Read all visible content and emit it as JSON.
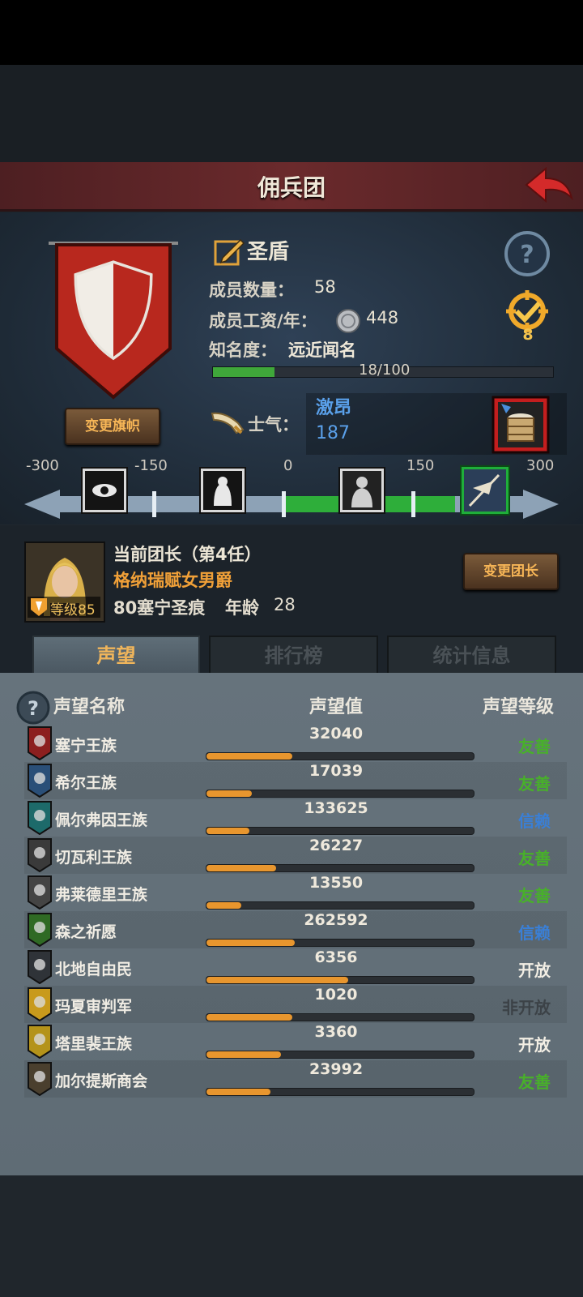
{
  "title": "佣兵团",
  "mercenary": {
    "name": "圣盾",
    "member_count_label": "成员数量：",
    "member_count": "58",
    "salary_label": "成员工资/年：",
    "salary": "448",
    "fame_label": "知名度：",
    "fame_value": "远近闻名",
    "fame_progress": "18/100",
    "fame_fraction": 0.18,
    "medal_count": "8",
    "change_flag_label": "变更旗帜"
  },
  "morale": {
    "label": "士气：",
    "state": "激昂",
    "value": "187",
    "ticks": [
      "-300",
      "-150",
      "0",
      "150",
      "300"
    ]
  },
  "leader": {
    "title": "当前团长（第4任）",
    "name": "格纳瑞赋女男爵",
    "info": "80塞宁圣痕",
    "age_label": "年龄",
    "age": "28",
    "level": "等级85",
    "change_label": "变更团长"
  },
  "tabs": [
    "声望",
    "排行榜",
    "统计信息"
  ],
  "table": {
    "headers": [
      "声望名称",
      "声望值",
      "声望等级"
    ],
    "rows": [
      {
        "name": "塞宁王族",
        "value": "32040",
        "fill": 0.32,
        "level": "友善",
        "color": "#48b02a",
        "icon": "#8c1f1f"
      },
      {
        "name": "希尔王族",
        "value": "17039",
        "fill": 0.17,
        "level": "友善",
        "color": "#48b02a",
        "icon": "#2a4f78"
      },
      {
        "name": "佩尔弗因王族",
        "value": "133625",
        "fill": 0.16,
        "level": "信赖",
        "color": "#3a7fd6",
        "icon": "#1d6a6a"
      },
      {
        "name": "切瓦利王族",
        "value": "26227",
        "fill": 0.26,
        "level": "友善",
        "color": "#48b02a",
        "icon": "#3a3a3a"
      },
      {
        "name": "弗莱德里王族",
        "value": "13550",
        "fill": 0.13,
        "level": "友善",
        "color": "#48b02a",
        "icon": "#444444"
      },
      {
        "name": "森之祈愿",
        "value": "262592",
        "fill": 0.33,
        "level": "信赖",
        "color": "#3a7fd6",
        "icon": "#2f6a24"
      },
      {
        "name": "北地自由民",
        "value": "6356",
        "fill": 0.53,
        "level": "开放",
        "color": "#f2eee4",
        "icon": "#2f3338"
      },
      {
        "name": "玛夏审判军",
        "value": "1020",
        "fill": 0.32,
        "level": "非开放",
        "color": "#3c4247",
        "icon": "#c89a1c"
      },
      {
        "name": "塔里裴王族",
        "value": "3360",
        "fill": 0.28,
        "level": "开放",
        "color": "#f2eee4",
        "icon": "#b4931a"
      },
      {
        "name": "加尔提斯商会",
        "value": "23992",
        "fill": 0.24,
        "level": "友善",
        "color": "#48b02a",
        "icon": "#4a3f2e"
      }
    ]
  }
}
